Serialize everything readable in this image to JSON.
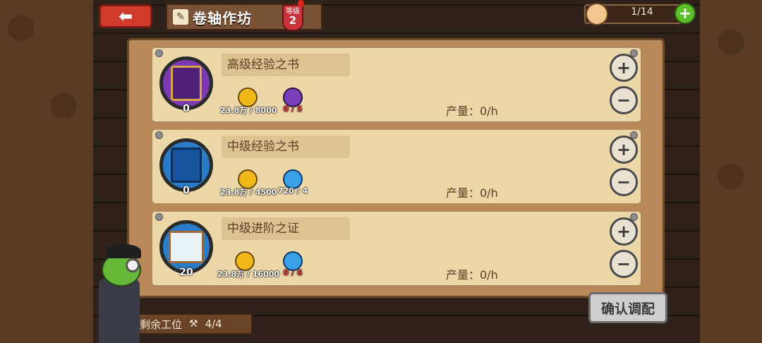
{
  "header": {
    "title": "卷轴作坊",
    "level_label": "等级",
    "level_value": "2",
    "slots": "1/14"
  },
  "items": [
    {
      "name": "高级经验之书",
      "count": "0",
      "gold_cost": "23.8万 / 8000",
      "gem_cost": "0 / 5",
      "gem_color": "purple",
      "output": "产量：0/h"
    },
    {
      "name": "中级经验之书",
      "count": "0",
      "gold_cost": "23.8万 / 4500",
      "gem_cost": "720 / 4",
      "gem_color": "blue",
      "output": "产量：0/h"
    },
    {
      "name": "中级进阶之证",
      "count": "20",
      "gold_cost": "23.8万 / 16000",
      "gem_cost": "0 / 6",
      "gem_color": "blue",
      "output": "产量：0/h"
    }
  ],
  "footer": {
    "workers_label": "剩余工位",
    "workers_value": "4/4",
    "confirm_label": "确认调配"
  }
}
